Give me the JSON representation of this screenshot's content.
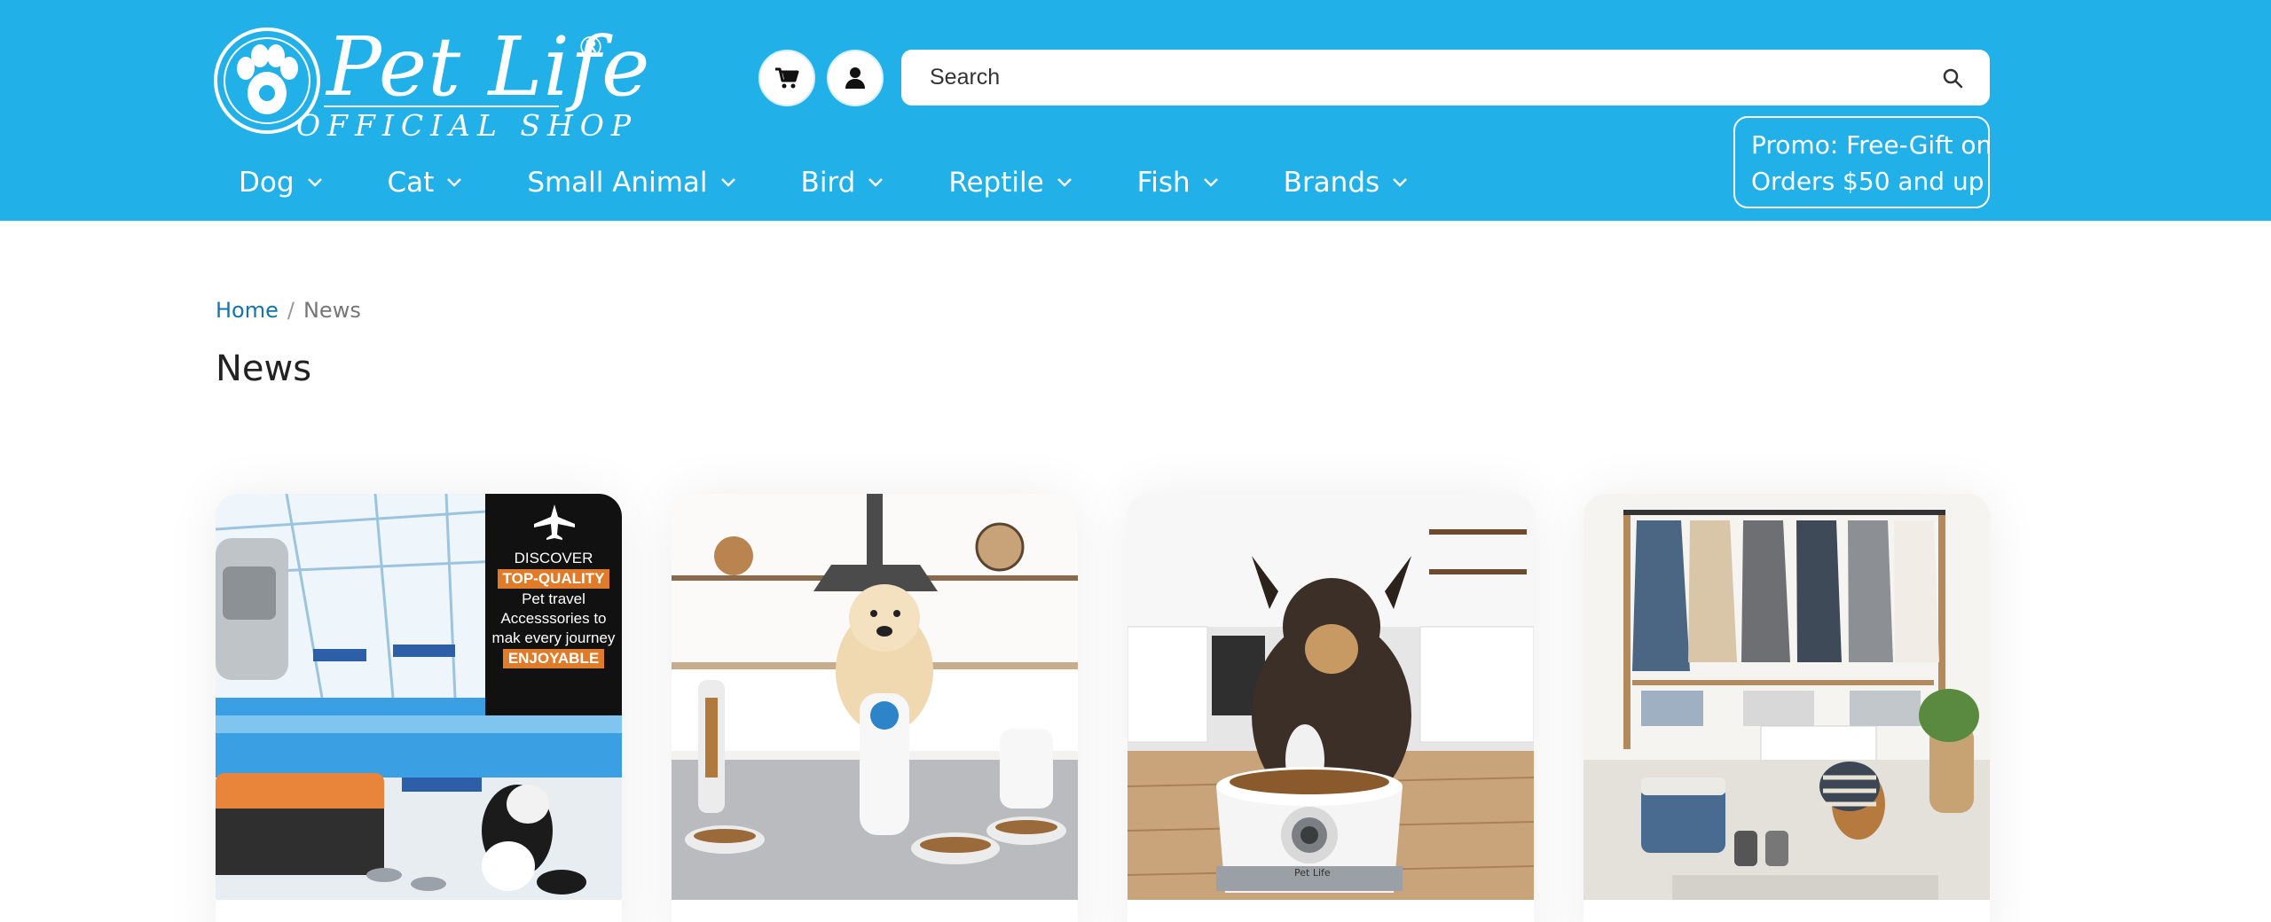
{
  "brand": {
    "title": "Pet Life",
    "registered": "®",
    "subtitle": "OFFICIAL SHOP"
  },
  "header": {
    "cart_icon": "cart-icon",
    "user_icon": "user-icon",
    "search_placeholder": "Search",
    "search_icon": "search-icon",
    "promo_line1": "Promo: Free-Gift on",
    "promo_line2": "Orders $50 and up",
    "background_color": "#21b0e8"
  },
  "nav": {
    "items": [
      {
        "label": "Dog"
      },
      {
        "label": "Cat"
      },
      {
        "label": "Small Animal"
      },
      {
        "label": "Bird"
      },
      {
        "label": "Reptile"
      },
      {
        "label": "Fish"
      },
      {
        "label": "Brands"
      }
    ]
  },
  "breadcrumb": {
    "home": "Home",
    "separator": "/",
    "current": "News"
  },
  "page": {
    "title": "News"
  },
  "cards": [
    {
      "image_desc": "travel-accessories",
      "overlay": {
        "line1": "DISCOVER",
        "highlight1": "TOP-QUALITY",
        "line2": "Pet travel",
        "line3": "Accesssories to",
        "line4": "mak every journey",
        "highlight2": "ENJOYABLE"
      }
    },
    {
      "image_desc": "feeders"
    },
    {
      "image_desc": "dog-bowl",
      "bowl_label": "Pet Life"
    },
    {
      "image_desc": "dog-clothing"
    }
  ]
}
